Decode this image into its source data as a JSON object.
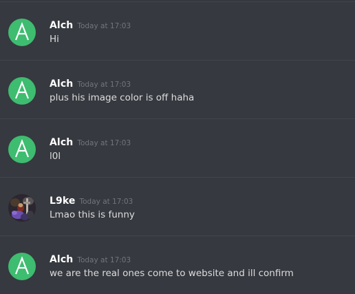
{
  "messages": [
    {
      "author": "Alch",
      "timestamp": "Today at 17:03",
      "text": "Hi",
      "avatar": "letter-avatar",
      "avatar_letter": "A"
    },
    {
      "author": "Alch",
      "timestamp": "Today at 17:03",
      "text": "plus his image color is off haha",
      "avatar": "letter-avatar",
      "avatar_letter": "A"
    },
    {
      "author": "Alch",
      "timestamp": "Today at 17:03",
      "text": "l0l",
      "avatar": "letter-avatar",
      "avatar_letter": "A"
    },
    {
      "author": "L9ke",
      "timestamp": "Today at 17:03",
      "text": "Lmao this is funny",
      "avatar": "picture-avatar"
    },
    {
      "author": "Alch",
      "timestamp": "Today at 17:03",
      "text": "we are the real ones come to website and ill confirm",
      "avatar": "letter-avatar",
      "avatar_letter": "A"
    }
  ],
  "colors": {
    "background": "#36393f",
    "divider": "#42454c",
    "author": "#ffffff",
    "timestamp": "#72767d",
    "message_text": "#dcddde",
    "avatar_green": "#3ebc70"
  }
}
